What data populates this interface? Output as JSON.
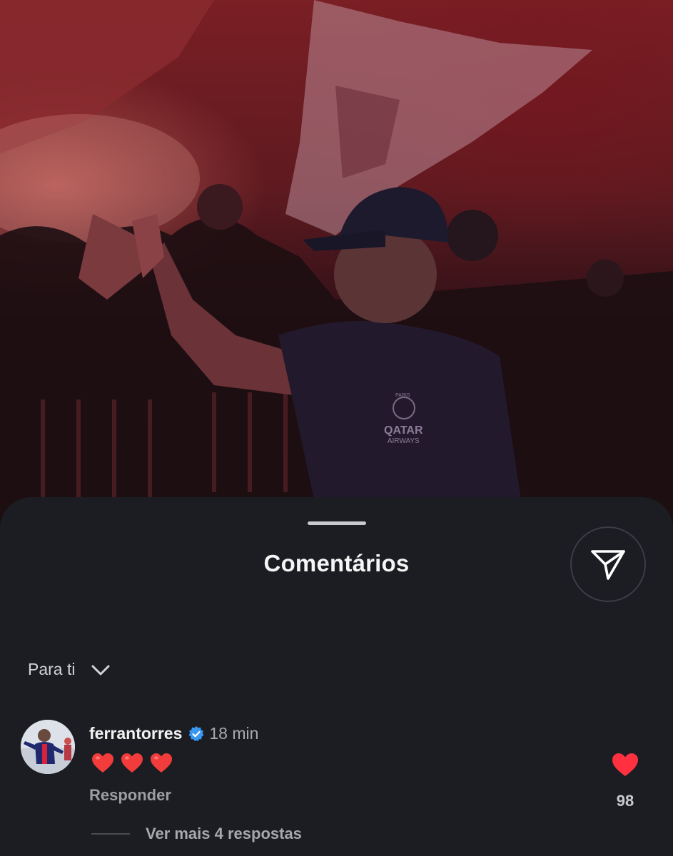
{
  "post": {
    "photo": {
      "subject": "player in PSG cap and Qatar Airways shirt high-fiving fans",
      "shirt_badge": "PARIS",
      "shirt_sponsor_line1": "QATAR",
      "shirt_sponsor_line2": "AIRWAYS"
    }
  },
  "comments_sheet": {
    "title": "Comentários",
    "share_icon": "paper-plane-icon",
    "sort_label": "Para ti",
    "sort_icon": "chevron-down-icon"
  },
  "comment": {
    "username": "ferrantorres",
    "verified": true,
    "time": "18 min",
    "text": "❤️❤️❤️",
    "reply_label": "Responder",
    "like_count": "98",
    "liked": true,
    "view_replies": "Ver mais 4 respostas"
  },
  "colors": {
    "sheet_bg": "#1b1d22",
    "like_red": "#ff3040",
    "verified_blue": "#3897f0"
  }
}
